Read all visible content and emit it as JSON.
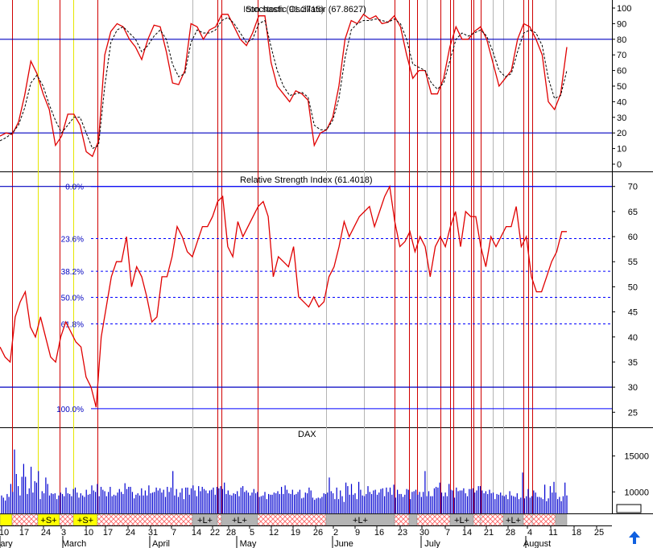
{
  "chart_data": [
    {
      "type": "line",
      "title": "Stochastic Oscillator (67.8627)",
      "overlay_title": "Icon stoch (91.2715)",
      "ylim": [
        0,
        100
      ],
      "yticks": [
        0,
        10,
        20,
        30,
        40,
        50,
        60,
        70,
        80,
        90,
        100
      ],
      "hlines": [
        20,
        80
      ],
      "series": [
        {
          "style": "solid red",
          "values": [
            18,
            20,
            19,
            27,
            44,
            66,
            58,
            45,
            35,
            12,
            18,
            32,
            32,
            25,
            8,
            5,
            15,
            70,
            85,
            90,
            88,
            80,
            75,
            67,
            80,
            89,
            88,
            72,
            52,
            51,
            60,
            90,
            88,
            80,
            86,
            88,
            96,
            96,
            88,
            80,
            76,
            84,
            95,
            95,
            65,
            50,
            45,
            40,
            47,
            45,
            41,
            12,
            20,
            22,
            30,
            50,
            80,
            92,
            90,
            96,
            93,
            95,
            90,
            91,
            95,
            88,
            70,
            55,
            60,
            60,
            45,
            45,
            55,
            75,
            88,
            80,
            80,
            85,
            88,
            80,
            65,
            50,
            55,
            60,
            80,
            90,
            88,
            80,
            70,
            40,
            35,
            45,
            75
          ]
        },
        {
          "style": "dashed black",
          "values": [
            15,
            17,
            20,
            25,
            36,
            52,
            57,
            50,
            38,
            28,
            20,
            25,
            30,
            30,
            20,
            10,
            12,
            50,
            78,
            86,
            88,
            84,
            80,
            72,
            76,
            82,
            86,
            80,
            64,
            56,
            58,
            78,
            86,
            84,
            84,
            86,
            92,
            94,
            90,
            84,
            78,
            80,
            90,
            92,
            75,
            60,
            50,
            44,
            45,
            46,
            43,
            25,
            22,
            22,
            28,
            42,
            68,
            86,
            90,
            92,
            92,
            93,
            92,
            91,
            93,
            90,
            80,
            64,
            62,
            60,
            52,
            48,
            52,
            66,
            80,
            84,
            82,
            84,
            86,
            82,
            72,
            60,
            56,
            58,
            72,
            84,
            86,
            84,
            76,
            55,
            42,
            44,
            60
          ]
        }
      ]
    },
    {
      "type": "line",
      "title": "Relative Strength Index (61.4018)",
      "ylim": [
        22,
        73
      ],
      "yticks": [
        25,
        30,
        35,
        40,
        45,
        50,
        55,
        60,
        65,
        70
      ],
      "hlines": [
        30,
        70
      ],
      "fib_levels": [
        {
          "label": "0.0%",
          "value": 70
        },
        {
          "label": "23.6%",
          "value": 59.6
        },
        {
          "label": "38.2%",
          "value": 53.1
        },
        {
          "label": "50.0%",
          "value": 47.9
        },
        {
          "label": "61.8%",
          "value": 42.6
        },
        {
          "label": "100.0%",
          "value": 25.7
        }
      ],
      "series": [
        {
          "style": "solid red",
          "values": [
            38,
            36,
            35,
            44,
            47,
            49,
            42,
            40,
            44,
            40,
            36,
            35,
            40,
            43,
            41,
            39,
            38,
            32,
            30,
            26,
            40,
            46,
            52,
            55,
            55,
            60,
            50,
            54,
            52,
            48,
            43,
            44,
            52,
            52,
            56,
            62,
            60,
            57,
            56,
            59,
            62,
            62,
            64,
            67,
            68,
            58,
            56,
            63,
            60,
            62,
            64,
            66,
            67,
            64,
            52,
            56,
            55,
            54,
            58,
            48,
            47,
            46,
            48,
            46,
            47,
            52,
            54,
            58,
            63,
            60,
            62,
            64,
            65,
            66,
            62,
            65,
            68,
            70,
            63,
            58,
            59,
            61,
            57,
            60,
            58,
            52,
            58,
            60,
            58,
            62,
            65,
            58,
            65,
            64,
            64,
            58,
            54,
            60,
            58,
            60,
            62,
            62,
            66,
            58,
            60,
            52,
            49,
            49,
            52,
            55,
            57,
            61,
            61
          ]
        }
      ]
    },
    {
      "type": "bar",
      "title": "DAX",
      "ylim": [
        7000,
        19000
      ],
      "yticks": [
        10000,
        15000
      ],
      "values": [
        9500,
        9200,
        8800,
        9700,
        9300,
        11100,
        10000,
        15900,
        12500,
        10800,
        9500,
        12100,
        13900,
        12100,
        9700,
        10500,
        13500,
        9900,
        11500,
        11300,
        12900,
        9000,
        10100,
        9800,
        12000,
        11100,
        9500,
        9800,
        9700,
        9800,
        9000,
        9500,
        9900,
        9700,
        9400,
        10600,
        9800,
        9700,
        9400,
        10400,
        10600,
        9900,
        9200,
        9800,
        9500,
        9300,
        10300,
        9600,
        9700,
        10900,
        10200,
        10000,
        11100,
        9400,
        10700,
        10300,
        10100,
        9400,
        10000,
        10700,
        9400,
        9600,
        9500,
        9900,
        10400,
        10000,
        9700,
        11200,
        10400,
        10700,
        10700,
        10000,
        9100,
        9600,
        9800,
        9500,
        10500,
        9500,
        10200,
        9500,
        10900,
        9800,
        9900,
        10000,
        10600,
        10200,
        10500,
        9900,
        10300,
        9300,
        10700,
        10000,
        10600,
        12900,
        9500,
        10400,
        9300,
        9900,
        10500,
        9000,
        10600,
        10600,
        9600,
        10500,
        10900,
        10200,
        9400,
        10800,
        10100,
        10700,
        10400,
        10200,
        9800,
        10200,
        10300,
        10600,
        9600,
        10700,
        10500,
        10800,
        10400,
        11300,
        9700,
        10200,
        9600,
        9500,
        9800,
        9700,
        10100,
        9400,
        10600,
        10800,
        10000,
        10200,
        9900,
        9500,
        9900,
        10400,
        9800,
        10000,
        9300,
        9400,
        9500,
        10000,
        9000,
        9700,
        9600,
        9600,
        9900,
        9800,
        10100,
        9700,
        10700,
        9700,
        10900,
        10300,
        9800,
        9700,
        10300,
        9600,
        9700,
        10000,
        10300,
        9100,
        9200,
        9900,
        9800,
        10600,
        10200,
        9200,
        8900,
        9100,
        9200,
        9100,
        9300,
        9800,
        9700,
        9900,
        12000,
        10100,
        9800,
        9000,
        10600,
        9000,
        10200,
        9400,
        8600,
        11300,
        10800,
        9600,
        11100,
        9600,
        9800,
        9000,
        11400,
        10300,
        9500,
        9400,
        9700,
        10800,
        10000,
        9700,
        10200,
        10300,
        9600,
        9900,
        10400,
        10500,
        9400,
        10600,
        10000,
        10600,
        9600,
        11000,
        9200,
        10300,
        9700,
        9700,
        9300,
        9600,
        10400,
        10300,
        9000,
        10000,
        10100,
        10300,
        9600,
        10000,
        9300,
        10000,
        12900,
        9400,
        10100,
        9400,
        9400,
        10500,
        10700,
        10600,
        11300,
        9900,
        9400,
        9900,
        9400,
        11100,
        10300,
        10200,
        9200,
        10600,
        10100,
        10200,
        10200,
        10500,
        9800,
        9400,
        10400,
        10400,
        10500,
        9900,
        10200,
        10800,
        10800,
        10200,
        9800,
        10100,
        9700,
        10300,
        9800,
        9900,
        9000,
        9700,
        9600,
        9900,
        9500,
        9400,
        9600,
        9000,
        10100,
        9500,
        9400,
        9300,
        9800,
        9000,
        9200,
        12700,
        9100,
        9400,
        10400,
        9200,
        9400,
        10200,
        9900,
        9300,
        9300,
        9200,
        9000,
        11000,
        8700,
        9100,
        10800,
        9900,
        11400,
        9900,
        9000,
        9300,
        8700,
        9400,
        11300,
        9500
      ]
    }
  ],
  "signal_bar": {
    "labels": [
      "+S+",
      "+S+",
      "+L+",
      "+L+",
      "+L+",
      "+L+",
      "+L+"
    ]
  },
  "x_axis": {
    "day_labels": [
      "10",
      "17",
      "24",
      "3",
      "10",
      "17",
      "24",
      "31",
      "7",
      "14",
      "22",
      "28",
      "5",
      "12",
      "19",
      "26",
      "2",
      "9",
      "16",
      "23",
      "30",
      "7",
      "14",
      "21",
      "28",
      "4",
      "11",
      "18",
      "25"
    ],
    "month_labels": [
      "ary",
      "March",
      "April",
      "May",
      "June",
      "July",
      "August"
    ]
  },
  "colors": {
    "price_line": "#e00000",
    "signal_line": "#000000",
    "hline": "#0000c0",
    "fib": "#0000ff",
    "red_marker": "#d00000",
    "yellow_marker": "#e6e600",
    "gray_marker": "#b4b4b4",
    "volume": "#0000d0"
  },
  "icons": {
    "scroll_right": "up-arrow-icon"
  }
}
